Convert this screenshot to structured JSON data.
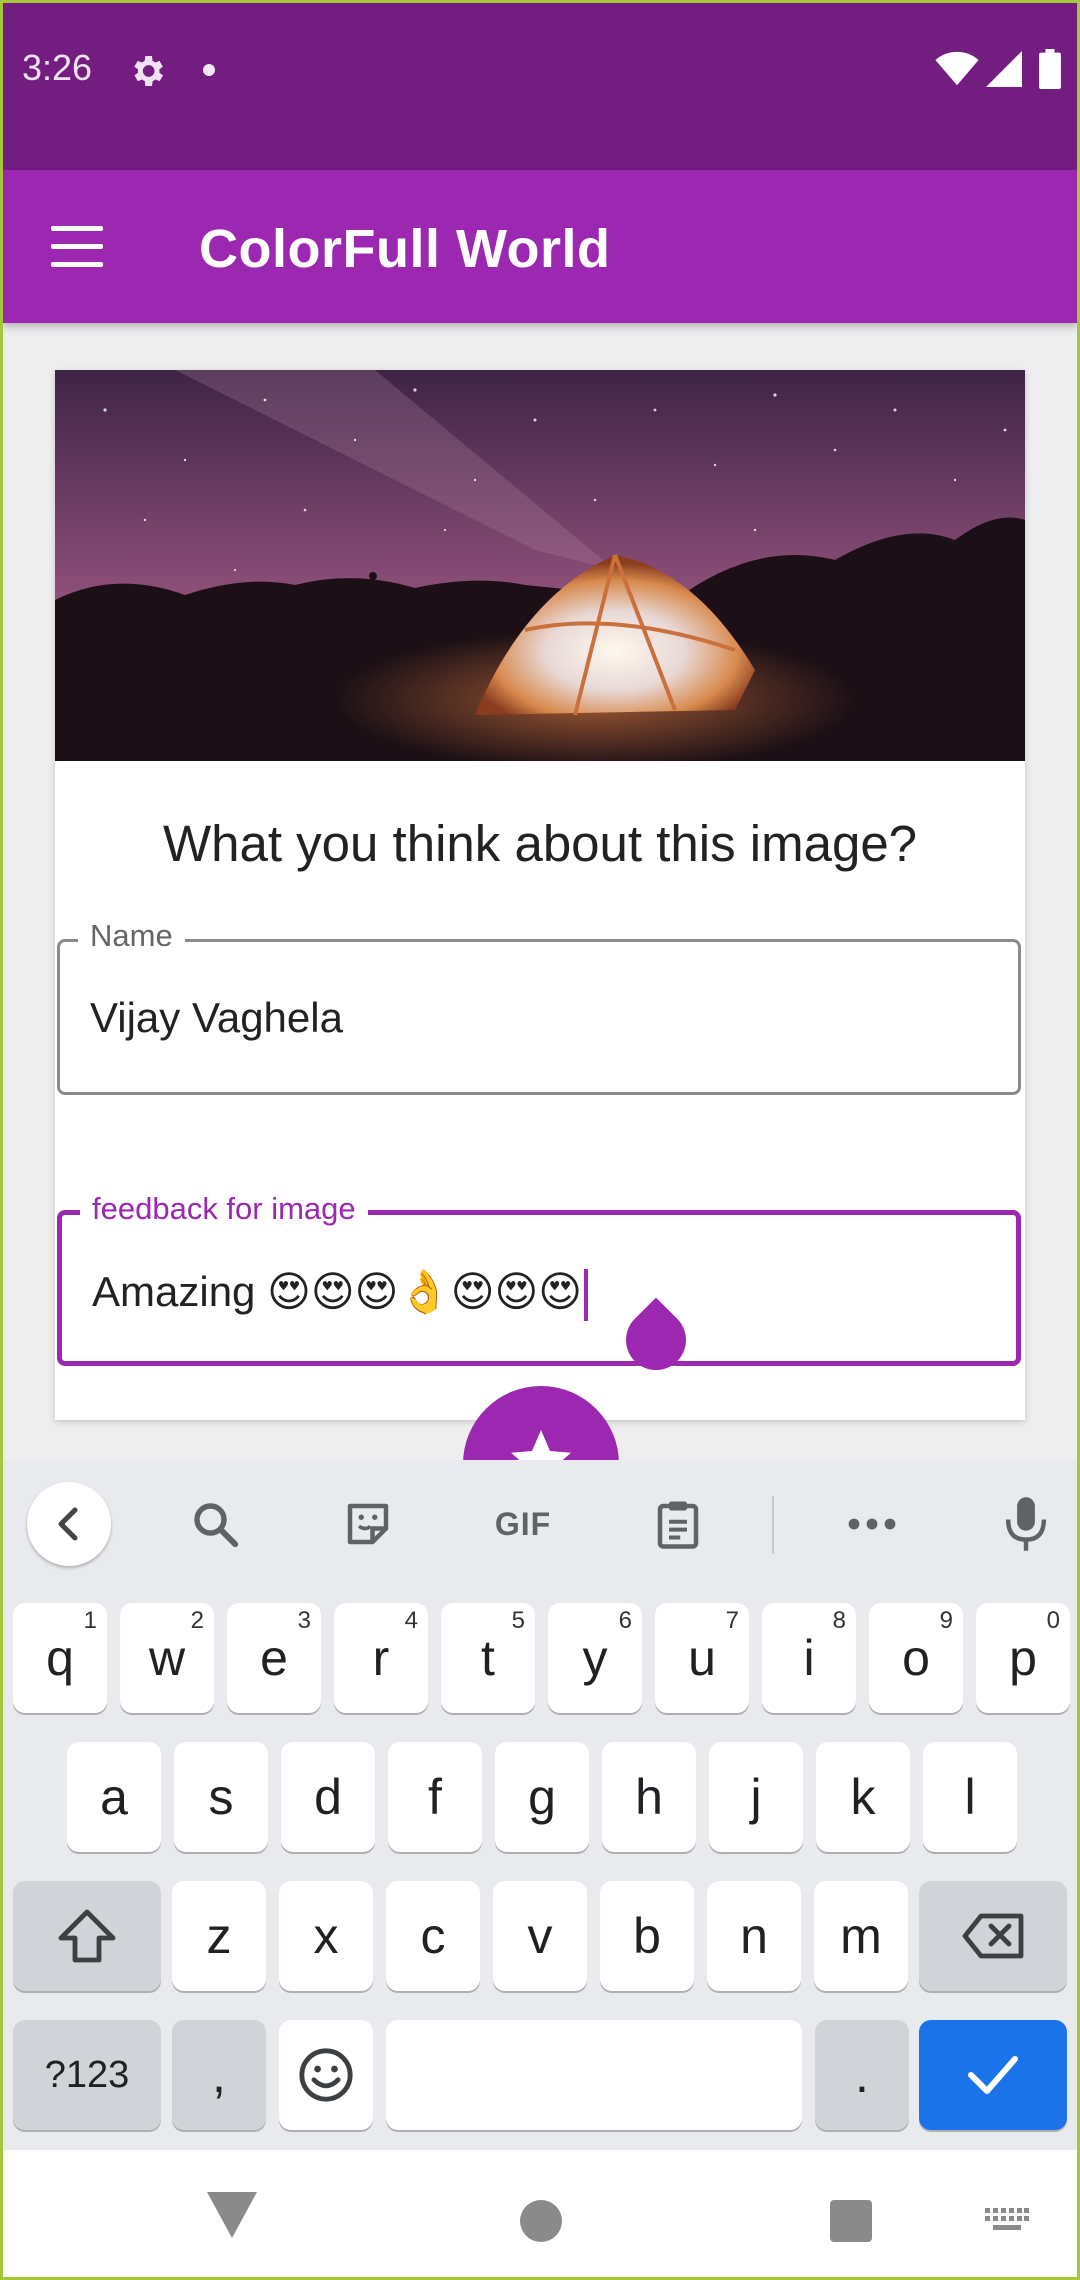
{
  "status_bar": {
    "time": "3:26",
    "icons": [
      "gear-icon",
      "notification-dot",
      "wifi-icon",
      "signal-icon",
      "battery-icon"
    ]
  },
  "app_bar": {
    "title": "ColorFull World",
    "menu_icon": "hamburger-menu-icon"
  },
  "card": {
    "image_description": "starry-night-tent",
    "question": "What you think about this image?",
    "name_field": {
      "label": "Name",
      "value": "Vijay Vaghela"
    },
    "feedback_field": {
      "label": "feedback for image",
      "value": "Amazing 😍😍😍👌😍😍😍"
    }
  },
  "fab": {
    "icon": "star-icon"
  },
  "keyboard": {
    "toolbar": [
      "back-arrow-icon",
      "search-icon",
      "sticker-icon",
      "GIF",
      "clipboard-icon",
      "more-icon",
      "mic-icon"
    ],
    "row1": [
      {
        "k": "q",
        "h": "1"
      },
      {
        "k": "w",
        "h": "2"
      },
      {
        "k": "e",
        "h": "3"
      },
      {
        "k": "r",
        "h": "4"
      },
      {
        "k": "t",
        "h": "5"
      },
      {
        "k": "y",
        "h": "6"
      },
      {
        "k": "u",
        "h": "7"
      },
      {
        "k": "i",
        "h": "8"
      },
      {
        "k": "o",
        "h": "9"
      },
      {
        "k": "p",
        "h": "0"
      }
    ],
    "row2": [
      "a",
      "s",
      "d",
      "f",
      "g",
      "h",
      "j",
      "k",
      "l"
    ],
    "row3": [
      "z",
      "x",
      "c",
      "v",
      "b",
      "n",
      "m"
    ],
    "symbols_key": "?123",
    "comma_key": ",",
    "period_key": ".",
    "shift_icon": "shift-icon",
    "backspace_icon": "backspace-icon",
    "emoji_icon": "emoji-icon",
    "enter_icon": "check-icon",
    "colors": {
      "enter": "#1a73e8"
    }
  },
  "nav_bar": {
    "icons": [
      "back-triangle-icon",
      "home-circle-icon",
      "recents-square-icon",
      "keyboard-hide-icon"
    ]
  },
  "colors": {
    "primary": "#9c27b0",
    "primary_dark": "#731d80",
    "background": "#eeeeee"
  }
}
